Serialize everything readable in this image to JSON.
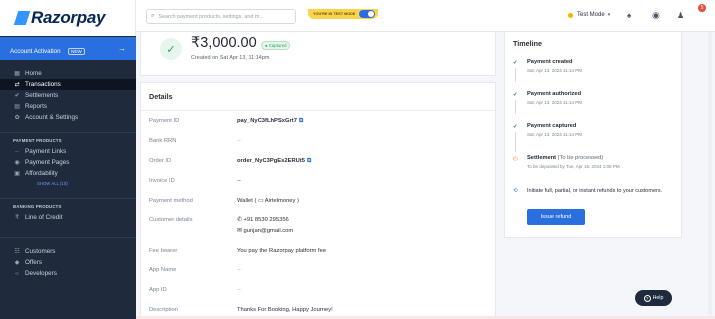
{
  "sidebar": {
    "logo_text": "Razorpay",
    "activation": {
      "label": "Account Activation",
      "badge": "NEW"
    },
    "items": [
      {
        "label": "Home",
        "icon": "home-icon",
        "glyph": "▦"
      },
      {
        "label": "Transactions",
        "icon": "transactions-icon",
        "glyph": "⇄",
        "active": true
      },
      {
        "label": "Settlements",
        "icon": "settlements-icon",
        "glyph": "✔"
      },
      {
        "label": "Reports",
        "icon": "reports-icon",
        "glyph": "▤"
      },
      {
        "label": "Account & Settings",
        "icon": "settings-icon",
        "glyph": "✿"
      }
    ],
    "payment_products_header": "PAYMENT PRODUCTS",
    "payment_products": [
      {
        "label": "Payment Links",
        "icon": "link-icon",
        "glyph": "⇔"
      },
      {
        "label": "Payment Pages",
        "icon": "page-icon",
        "glyph": "◉"
      },
      {
        "label": "Affordability",
        "icon": "affordability-icon",
        "glyph": "▣"
      }
    ],
    "show_all": "SHOW ALL (10)",
    "banking_products_header": "BANKING PRODUCTS",
    "banking_products": [
      {
        "label": "Line of Credit",
        "icon": "rupee-icon",
        "glyph": "₹"
      }
    ],
    "bottom_items": [
      {
        "label": "Customers",
        "icon": "customers-icon",
        "glyph": "☷"
      },
      {
        "label": "Offers",
        "icon": "offers-icon",
        "glyph": "◆"
      },
      {
        "label": "Developers",
        "icon": "developers-icon",
        "glyph": "‹›"
      }
    ]
  },
  "topbar": {
    "search_placeholder": "Search payment products, settings, and m...",
    "test_mode_banner": "YOU'RE IN TEST MODE",
    "mode_label": "Test Mode",
    "notification_count": "5"
  },
  "payment": {
    "amount": "₹3,000.00",
    "status": "Captured",
    "created_on": "Created on Sat Apr 13, 11:14pm"
  },
  "details": {
    "title": "Details",
    "rows": [
      {
        "key": "Payment ID",
        "value": "pay_NyC3fLhPSxGrt7",
        "copy": true,
        "bold": true
      },
      {
        "key": "Bank RRN",
        "value": "--",
        "muted": true
      },
      {
        "key": "Order ID",
        "value": "order_NyC3PgEs2ERUt5",
        "copy": true,
        "bold": true
      },
      {
        "key": "Invoice ID",
        "value": "--"
      },
      {
        "key": "Payment method",
        "value": "Wallet  ( ▭ Airtelmoney )"
      },
      {
        "key": "Customer details",
        "value": "+91 8530 295356",
        "value2": "gunjan@gmail.com"
      },
      {
        "key": "Fee bearer",
        "value": "You pay the Razorpay platform fee"
      },
      {
        "key": "App Name",
        "value": "--",
        "muted": true
      },
      {
        "key": "App ID",
        "value": "--",
        "muted": true
      },
      {
        "key": "Description",
        "value": "Thanks For Booking, Happy Journey!"
      }
    ]
  },
  "timeline": {
    "title": "Timeline",
    "events": [
      {
        "title": "Payment created",
        "date": "Sat, Apr 13, 2024 11:14 PM"
      },
      {
        "title": "Payment authorized",
        "date": "Sat, Apr 13, 2024 11:14 PM"
      },
      {
        "title": "Payment captured",
        "date": "Sat, Apr 13, 2024 11:14 PM"
      }
    ],
    "settlement": {
      "title": "Settlement",
      "sub": "(To be processed)",
      "date": "To be deposited by Tue, Apr 16, 2024 1:00 PM"
    },
    "refund_prompt": "Initiate full, partial, or instant refunds to your customers.",
    "refund_button": "Issue refund"
  },
  "help": {
    "label": "Help"
  }
}
